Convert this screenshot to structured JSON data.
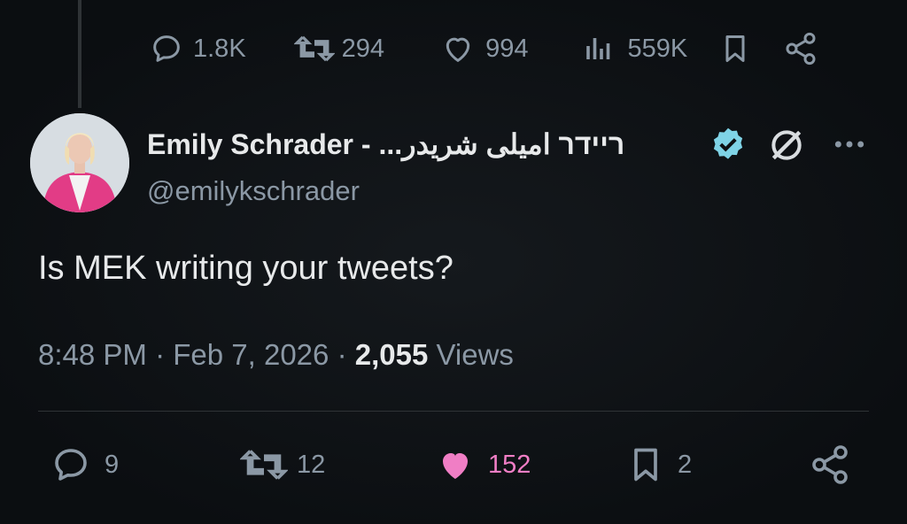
{
  "parent_tweet": {
    "replies": "1.8K",
    "reposts": "294",
    "likes": "994",
    "views": "559K"
  },
  "tweet": {
    "author_name": "Emily Schrader - ...ריידר اميلى شريدر",
    "author_handle": "@emilykschrader",
    "text": "Is MEK writing your tweets?",
    "time": "8:48 PM",
    "date": "Feb 7, 2026",
    "views_count": "2,055",
    "views_label": "Views",
    "replies": "9",
    "reposts": "12",
    "likes": "152",
    "bookmarks": "2"
  },
  "colors": {
    "background": "#0d1013",
    "text_primary": "#e7e9ea",
    "text_secondary": "#8b98a5",
    "like_active": "#f91880",
    "verified_badge": "#7fd3e6"
  },
  "icons": [
    "reply-icon",
    "repost-icon",
    "like-icon",
    "views-icon",
    "bookmark-icon",
    "share-icon",
    "verified-badge-icon",
    "no-entry-icon",
    "more-icon"
  ]
}
